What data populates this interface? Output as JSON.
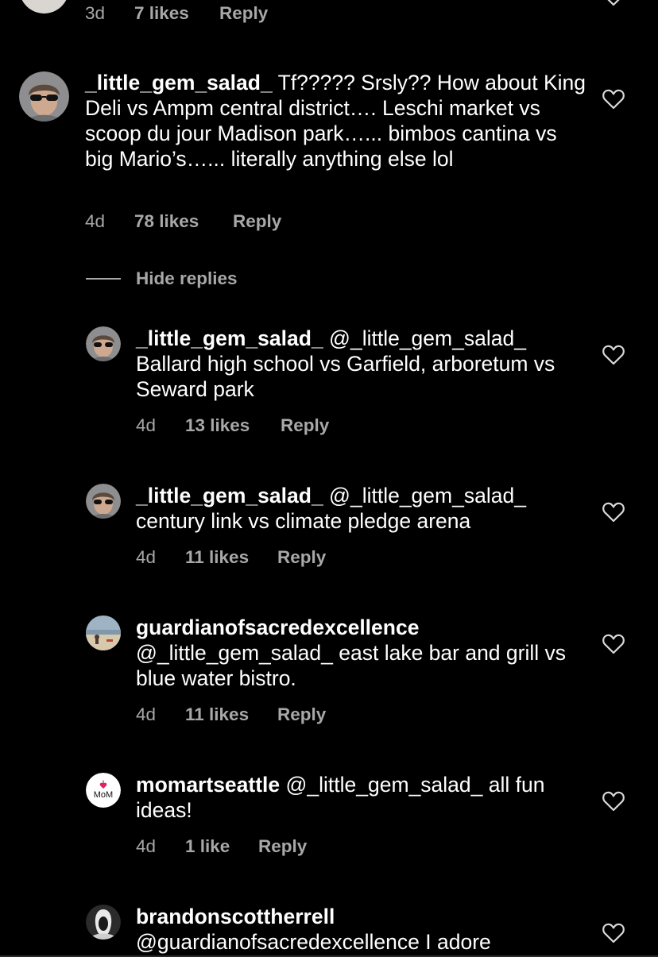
{
  "colors": {
    "background": "#000000",
    "text": "#ffffff",
    "secondary_text": "#a8a8a8"
  },
  "top_partial": {
    "age": "3d",
    "likes": "7 likes",
    "reply": "Reply"
  },
  "main_comment": {
    "username": "_little_gem_salad_",
    "text": " Tf????? Srsly?? How about King Deli vs Ampm central district…. Leschi market vs scoop du jour Madison park…... bimbos cantina vs big Mario’s…... literally anything else lol",
    "age": "4d",
    "likes": "78 likes",
    "reply": "Reply",
    "icon": "heart-outline-icon"
  },
  "hide_replies_label": "Hide replies",
  "replies": [
    {
      "username": "_little_gem_salad_",
      "text": " @_little_gem_salad_ Ballard high school vs Garfield, arboretum vs Seward park",
      "age": "4d",
      "likes": "13 likes",
      "reply": "Reply"
    },
    {
      "username": "_little_gem_salad_",
      "text": " @_little_gem_salad_ century link vs climate pledge arena",
      "age": "4d",
      "likes": "11 likes",
      "reply": "Reply"
    },
    {
      "username": "guardianofsacredexcellence",
      "text": "@_little_gem_salad_ east lake bar and grill vs blue water bistro.",
      "age": "4d",
      "likes": "11 likes",
      "reply": "Reply"
    },
    {
      "username": "momartseattle",
      "text": " @_little_gem_salad_ all fun ideas!",
      "age": "4d",
      "likes": "1 like",
      "reply": "Reply",
      "avatar_text": "I ♥ MoM"
    },
    {
      "username": "brandonscottherrell",
      "text": "@guardianofsacredexcellence I adore"
    }
  ]
}
